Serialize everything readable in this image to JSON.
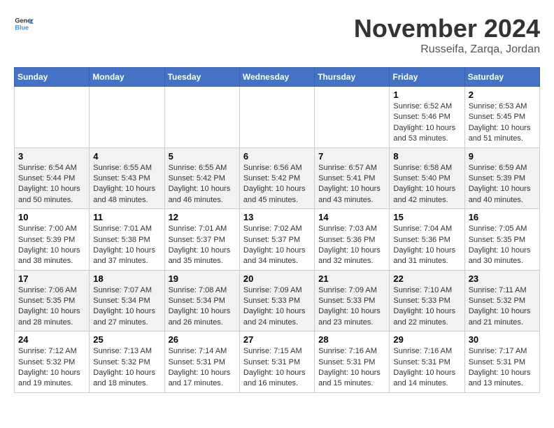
{
  "logo": {
    "text_general": "General",
    "text_blue": "Blue"
  },
  "title": {
    "month": "November 2024",
    "location": "Russeifa, Zarqa, Jordan"
  },
  "headers": [
    "Sunday",
    "Monday",
    "Tuesday",
    "Wednesday",
    "Thursday",
    "Friday",
    "Saturday"
  ],
  "rows": [
    [
      {
        "day": "",
        "info": ""
      },
      {
        "day": "",
        "info": ""
      },
      {
        "day": "",
        "info": ""
      },
      {
        "day": "",
        "info": ""
      },
      {
        "day": "",
        "info": ""
      },
      {
        "day": "1",
        "info": "Sunrise: 6:52 AM\nSunset: 5:46 PM\nDaylight: 10 hours and 53 minutes."
      },
      {
        "day": "2",
        "info": "Sunrise: 6:53 AM\nSunset: 5:45 PM\nDaylight: 10 hours and 51 minutes."
      }
    ],
    [
      {
        "day": "3",
        "info": "Sunrise: 6:54 AM\nSunset: 5:44 PM\nDaylight: 10 hours and 50 minutes."
      },
      {
        "day": "4",
        "info": "Sunrise: 6:55 AM\nSunset: 5:43 PM\nDaylight: 10 hours and 48 minutes."
      },
      {
        "day": "5",
        "info": "Sunrise: 6:55 AM\nSunset: 5:42 PM\nDaylight: 10 hours and 46 minutes."
      },
      {
        "day": "6",
        "info": "Sunrise: 6:56 AM\nSunset: 5:42 PM\nDaylight: 10 hours and 45 minutes."
      },
      {
        "day": "7",
        "info": "Sunrise: 6:57 AM\nSunset: 5:41 PM\nDaylight: 10 hours and 43 minutes."
      },
      {
        "day": "8",
        "info": "Sunrise: 6:58 AM\nSunset: 5:40 PM\nDaylight: 10 hours and 42 minutes."
      },
      {
        "day": "9",
        "info": "Sunrise: 6:59 AM\nSunset: 5:39 PM\nDaylight: 10 hours and 40 minutes."
      }
    ],
    [
      {
        "day": "10",
        "info": "Sunrise: 7:00 AM\nSunset: 5:39 PM\nDaylight: 10 hours and 38 minutes."
      },
      {
        "day": "11",
        "info": "Sunrise: 7:01 AM\nSunset: 5:38 PM\nDaylight: 10 hours and 37 minutes."
      },
      {
        "day": "12",
        "info": "Sunrise: 7:01 AM\nSunset: 5:37 PM\nDaylight: 10 hours and 35 minutes."
      },
      {
        "day": "13",
        "info": "Sunrise: 7:02 AM\nSunset: 5:37 PM\nDaylight: 10 hours and 34 minutes."
      },
      {
        "day": "14",
        "info": "Sunrise: 7:03 AM\nSunset: 5:36 PM\nDaylight: 10 hours and 32 minutes."
      },
      {
        "day": "15",
        "info": "Sunrise: 7:04 AM\nSunset: 5:36 PM\nDaylight: 10 hours and 31 minutes."
      },
      {
        "day": "16",
        "info": "Sunrise: 7:05 AM\nSunset: 5:35 PM\nDaylight: 10 hours and 30 minutes."
      }
    ],
    [
      {
        "day": "17",
        "info": "Sunrise: 7:06 AM\nSunset: 5:35 PM\nDaylight: 10 hours and 28 minutes."
      },
      {
        "day": "18",
        "info": "Sunrise: 7:07 AM\nSunset: 5:34 PM\nDaylight: 10 hours and 27 minutes."
      },
      {
        "day": "19",
        "info": "Sunrise: 7:08 AM\nSunset: 5:34 PM\nDaylight: 10 hours and 26 minutes."
      },
      {
        "day": "20",
        "info": "Sunrise: 7:09 AM\nSunset: 5:33 PM\nDaylight: 10 hours and 24 minutes."
      },
      {
        "day": "21",
        "info": "Sunrise: 7:09 AM\nSunset: 5:33 PM\nDaylight: 10 hours and 23 minutes."
      },
      {
        "day": "22",
        "info": "Sunrise: 7:10 AM\nSunset: 5:33 PM\nDaylight: 10 hours and 22 minutes."
      },
      {
        "day": "23",
        "info": "Sunrise: 7:11 AM\nSunset: 5:32 PM\nDaylight: 10 hours and 21 minutes."
      }
    ],
    [
      {
        "day": "24",
        "info": "Sunrise: 7:12 AM\nSunset: 5:32 PM\nDaylight: 10 hours and 19 minutes."
      },
      {
        "day": "25",
        "info": "Sunrise: 7:13 AM\nSunset: 5:32 PM\nDaylight: 10 hours and 18 minutes."
      },
      {
        "day": "26",
        "info": "Sunrise: 7:14 AM\nSunset: 5:31 PM\nDaylight: 10 hours and 17 minutes."
      },
      {
        "day": "27",
        "info": "Sunrise: 7:15 AM\nSunset: 5:31 PM\nDaylight: 10 hours and 16 minutes."
      },
      {
        "day": "28",
        "info": "Sunrise: 7:16 AM\nSunset: 5:31 PM\nDaylight: 10 hours and 15 minutes."
      },
      {
        "day": "29",
        "info": "Sunrise: 7:16 AM\nSunset: 5:31 PM\nDaylight: 10 hours and 14 minutes."
      },
      {
        "day": "30",
        "info": "Sunrise: 7:17 AM\nSunset: 5:31 PM\nDaylight: 10 hours and 13 minutes."
      }
    ]
  ]
}
